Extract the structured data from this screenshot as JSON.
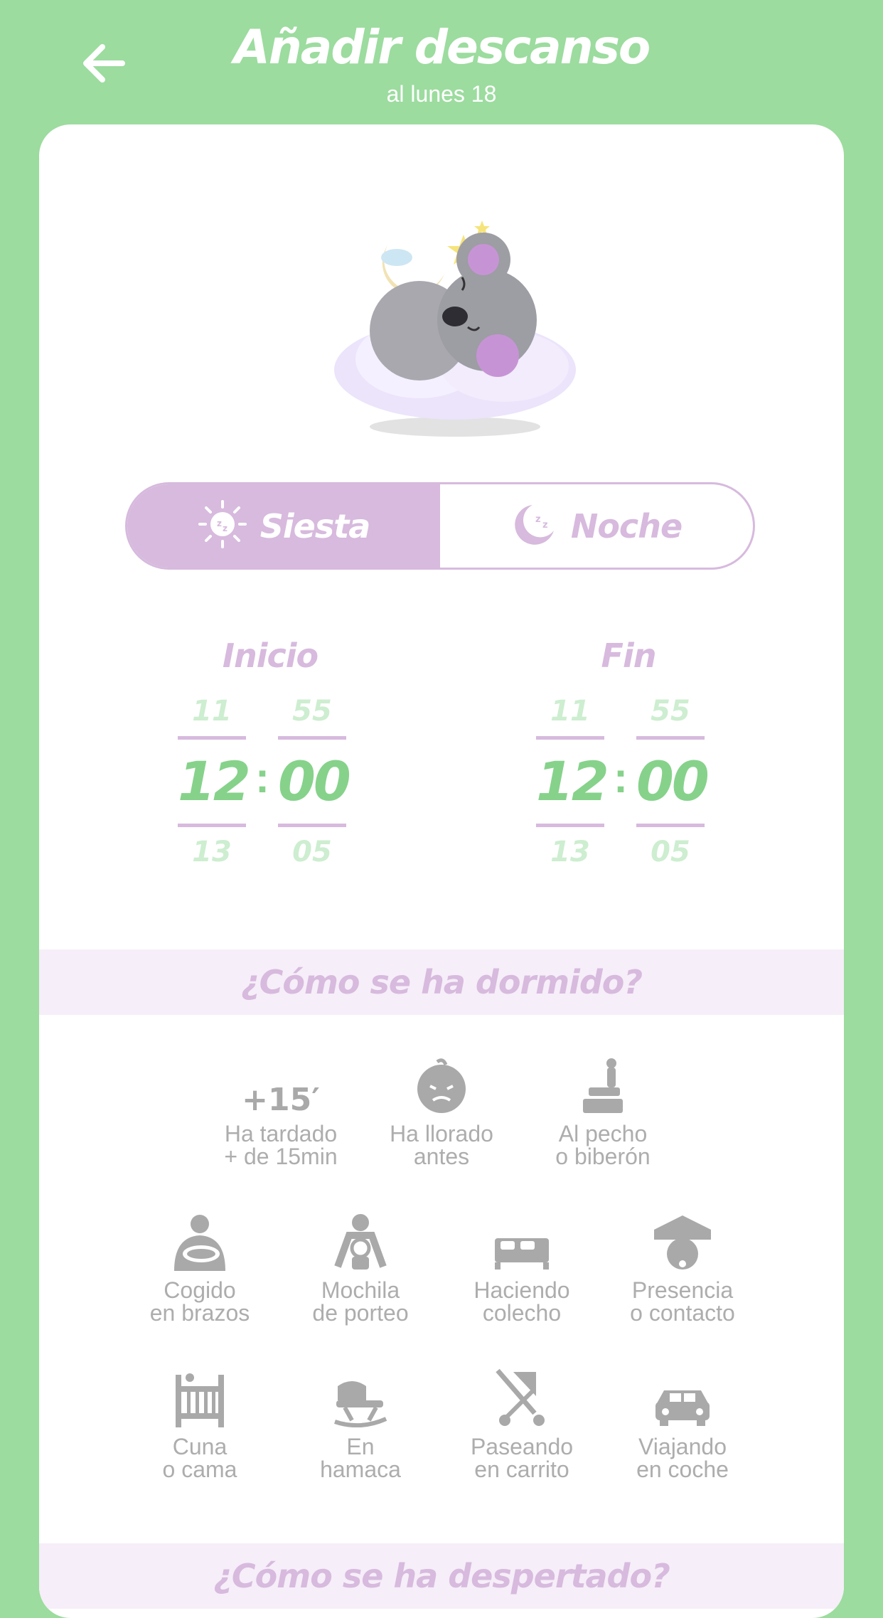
{
  "header": {
    "title": "Añadir descanso",
    "subtitle": "al lunes 18"
  },
  "toggle": {
    "siesta": "Siesta",
    "noche": "Noche",
    "selected": "Siesta"
  },
  "times": {
    "start": {
      "label": "Inicio",
      "hour_prev": "11",
      "hour": "12",
      "hour_next": "13",
      "min_prev": "55",
      "min": "00",
      "min_next": "05"
    },
    "end": {
      "label": "Fin",
      "hour_prev": "11",
      "hour": "12",
      "hour_next": "13",
      "min_prev": "55",
      "min": "00",
      "min_next": "05"
    }
  },
  "sleep_section": {
    "title": "¿Cómo se ha dormido?",
    "late_badge": "+15′",
    "options": [
      {
        "line1": "Ha tardado",
        "line2": "+ de 15min",
        "icon": "plus-15-icon"
      },
      {
        "line1": "Ha llorado",
        "line2": "antes",
        "icon": "crying-baby-icon"
      },
      {
        "line1": "Al pecho",
        "line2": "o biberón",
        "icon": "bottle-icon"
      },
      {
        "line1": "Cogido",
        "line2": "en brazos",
        "icon": "holding-baby-icon"
      },
      {
        "line1": "Mochila",
        "line2": "de porteo",
        "icon": "baby-carrier-icon"
      },
      {
        "line1": "Haciendo",
        "line2": "colecho",
        "icon": "bed-icon"
      },
      {
        "line1": "Presencia",
        "line2": "o contacto",
        "icon": "hand-on-baby-icon"
      },
      {
        "line1": "Cuna",
        "line2": "o cama",
        "icon": "crib-icon"
      },
      {
        "line1": "En",
        "line2": "hamaca",
        "icon": "rocker-icon"
      },
      {
        "line1": "Paseando",
        "line2": "en carrito",
        "icon": "stroller-icon"
      },
      {
        "line1": "Viajando",
        "line2": "en coche",
        "icon": "car-icon"
      }
    ]
  },
  "wake_section": {
    "title": "¿Cómo se ha despertado?"
  },
  "colors": {
    "green_bg": "#9cdc9f",
    "lilac": "#d7bade",
    "green_text": "#86d28b",
    "grey_icon": "#a9a9a9"
  }
}
